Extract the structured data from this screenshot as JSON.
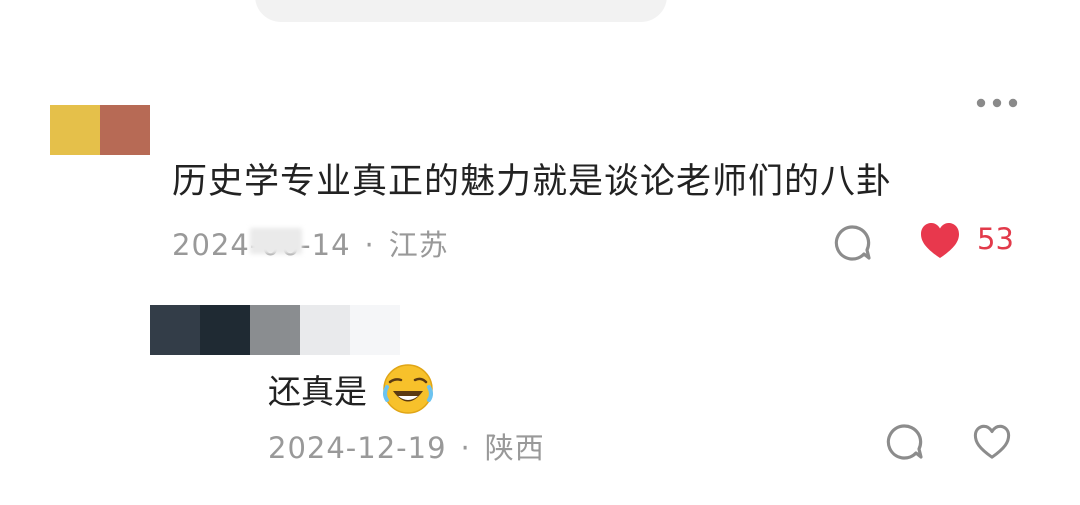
{
  "comment": {
    "text": "历史学专业真正的魅力就是谈论老师们的八卦",
    "date": "2024-06-14",
    "separator": "·",
    "location": "江苏",
    "like_count": "53",
    "liked": true,
    "accent_color": "#e8384d"
  },
  "reply": {
    "text": "还真是",
    "emoji": "crying-laughing-emoji",
    "date": "2024-12-19",
    "separator": "·",
    "location": "陕西",
    "liked": false
  },
  "icons": {
    "more": "more-dots-icon",
    "comment": "comment-bubble-icon",
    "like": "heart-icon"
  }
}
